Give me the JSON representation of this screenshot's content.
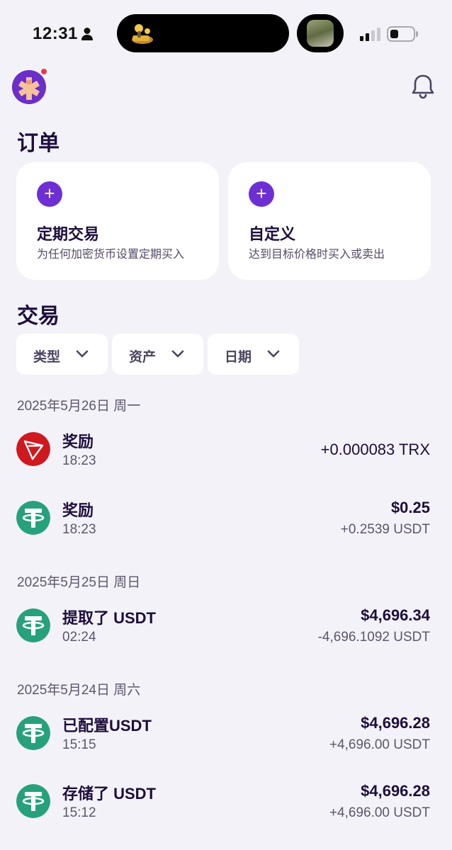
{
  "status_bar": {
    "time": "12:31",
    "icons": [
      "person-icon",
      "signal-icon",
      "battery-icon"
    ]
  },
  "header": {
    "avatar_icon": "app-avatar-icon",
    "notification_icon": "bell-icon"
  },
  "orders": {
    "title": "订单",
    "cards": [
      {
        "title": "定期交易",
        "subtitle": "为任何加密货币设置定期买入",
        "icon": "plus-icon"
      },
      {
        "title": "自定义",
        "subtitle": "达到目标价格时买入或卖出",
        "icon": "plus-icon"
      }
    ]
  },
  "transactions": {
    "title": "交易",
    "filters": [
      {
        "label": "类型"
      },
      {
        "label": "资产"
      },
      {
        "label": "日期"
      }
    ],
    "groups": [
      {
        "date": "2025年5月26日 周一",
        "items": [
          {
            "title": "奖励",
            "time": "18:23",
            "amount": "+0.000083 TRX",
            "sub": "",
            "icon": "trx-icon"
          },
          {
            "title": "奖励",
            "time": "18:23",
            "amount": "$0.25",
            "sub": "+0.2539 USDT",
            "icon": "usdt-icon"
          }
        ]
      },
      {
        "date": "2025年5月25日 周日",
        "items": [
          {
            "title": "提取了 USDT",
            "time": "02:24",
            "amount": "$4,696.34",
            "sub": "-4,696.1092 USDT",
            "icon": "usdt-icon"
          }
        ]
      },
      {
        "date": "2025年5月24日 周六",
        "items": [
          {
            "title": "已配置USDT",
            "time": "15:15",
            "amount": "$4,696.28",
            "sub": "+4,696.00 USDT",
            "icon": "usdt-icon"
          },
          {
            "title": "存储了 USDT",
            "time": "15:12",
            "amount": "$4,696.28",
            "sub": "+4,696.00 USDT",
            "icon": "usdt-icon"
          }
        ]
      }
    ]
  },
  "colors": {
    "background": "#f3f2f8",
    "accent": "#6d2fd4",
    "text_primary": "#1e0d3c",
    "text_secondary": "#5c566b",
    "trx_red": "#d0191f",
    "usdt_green": "#26a17b",
    "notification_dot": "#f0374c"
  }
}
